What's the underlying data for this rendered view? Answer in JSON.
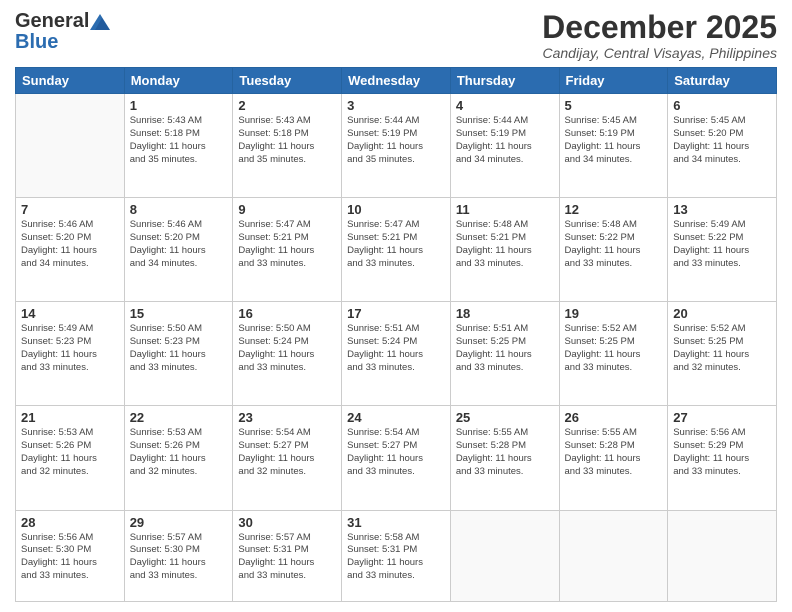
{
  "header": {
    "logo_general": "General",
    "logo_blue": "Blue",
    "month_title": "December 2025",
    "location": "Candijay, Central Visayas, Philippines"
  },
  "days_of_week": [
    "Sunday",
    "Monday",
    "Tuesday",
    "Wednesday",
    "Thursday",
    "Friday",
    "Saturday"
  ],
  "weeks": [
    [
      {
        "day": "",
        "info": ""
      },
      {
        "day": "1",
        "info": "Sunrise: 5:43 AM\nSunset: 5:18 PM\nDaylight: 11 hours\nand 35 minutes."
      },
      {
        "day": "2",
        "info": "Sunrise: 5:43 AM\nSunset: 5:18 PM\nDaylight: 11 hours\nand 35 minutes."
      },
      {
        "day": "3",
        "info": "Sunrise: 5:44 AM\nSunset: 5:19 PM\nDaylight: 11 hours\nand 35 minutes."
      },
      {
        "day": "4",
        "info": "Sunrise: 5:44 AM\nSunset: 5:19 PM\nDaylight: 11 hours\nand 34 minutes."
      },
      {
        "day": "5",
        "info": "Sunrise: 5:45 AM\nSunset: 5:19 PM\nDaylight: 11 hours\nand 34 minutes."
      },
      {
        "day": "6",
        "info": "Sunrise: 5:45 AM\nSunset: 5:20 PM\nDaylight: 11 hours\nand 34 minutes."
      }
    ],
    [
      {
        "day": "7",
        "info": "Sunrise: 5:46 AM\nSunset: 5:20 PM\nDaylight: 11 hours\nand 34 minutes."
      },
      {
        "day": "8",
        "info": "Sunrise: 5:46 AM\nSunset: 5:20 PM\nDaylight: 11 hours\nand 34 minutes."
      },
      {
        "day": "9",
        "info": "Sunrise: 5:47 AM\nSunset: 5:21 PM\nDaylight: 11 hours\nand 33 minutes."
      },
      {
        "day": "10",
        "info": "Sunrise: 5:47 AM\nSunset: 5:21 PM\nDaylight: 11 hours\nand 33 minutes."
      },
      {
        "day": "11",
        "info": "Sunrise: 5:48 AM\nSunset: 5:21 PM\nDaylight: 11 hours\nand 33 minutes."
      },
      {
        "day": "12",
        "info": "Sunrise: 5:48 AM\nSunset: 5:22 PM\nDaylight: 11 hours\nand 33 minutes."
      },
      {
        "day": "13",
        "info": "Sunrise: 5:49 AM\nSunset: 5:22 PM\nDaylight: 11 hours\nand 33 minutes."
      }
    ],
    [
      {
        "day": "14",
        "info": "Sunrise: 5:49 AM\nSunset: 5:23 PM\nDaylight: 11 hours\nand 33 minutes."
      },
      {
        "day": "15",
        "info": "Sunrise: 5:50 AM\nSunset: 5:23 PM\nDaylight: 11 hours\nand 33 minutes."
      },
      {
        "day": "16",
        "info": "Sunrise: 5:50 AM\nSunset: 5:24 PM\nDaylight: 11 hours\nand 33 minutes."
      },
      {
        "day": "17",
        "info": "Sunrise: 5:51 AM\nSunset: 5:24 PM\nDaylight: 11 hours\nand 33 minutes."
      },
      {
        "day": "18",
        "info": "Sunrise: 5:51 AM\nSunset: 5:25 PM\nDaylight: 11 hours\nand 33 minutes."
      },
      {
        "day": "19",
        "info": "Sunrise: 5:52 AM\nSunset: 5:25 PM\nDaylight: 11 hours\nand 33 minutes."
      },
      {
        "day": "20",
        "info": "Sunrise: 5:52 AM\nSunset: 5:25 PM\nDaylight: 11 hours\nand 32 minutes."
      }
    ],
    [
      {
        "day": "21",
        "info": "Sunrise: 5:53 AM\nSunset: 5:26 PM\nDaylight: 11 hours\nand 32 minutes."
      },
      {
        "day": "22",
        "info": "Sunrise: 5:53 AM\nSunset: 5:26 PM\nDaylight: 11 hours\nand 32 minutes."
      },
      {
        "day": "23",
        "info": "Sunrise: 5:54 AM\nSunset: 5:27 PM\nDaylight: 11 hours\nand 32 minutes."
      },
      {
        "day": "24",
        "info": "Sunrise: 5:54 AM\nSunset: 5:27 PM\nDaylight: 11 hours\nand 33 minutes."
      },
      {
        "day": "25",
        "info": "Sunrise: 5:55 AM\nSunset: 5:28 PM\nDaylight: 11 hours\nand 33 minutes."
      },
      {
        "day": "26",
        "info": "Sunrise: 5:55 AM\nSunset: 5:28 PM\nDaylight: 11 hours\nand 33 minutes."
      },
      {
        "day": "27",
        "info": "Sunrise: 5:56 AM\nSunset: 5:29 PM\nDaylight: 11 hours\nand 33 minutes."
      }
    ],
    [
      {
        "day": "28",
        "info": "Sunrise: 5:56 AM\nSunset: 5:30 PM\nDaylight: 11 hours\nand 33 minutes."
      },
      {
        "day": "29",
        "info": "Sunrise: 5:57 AM\nSunset: 5:30 PM\nDaylight: 11 hours\nand 33 minutes."
      },
      {
        "day": "30",
        "info": "Sunrise: 5:57 AM\nSunset: 5:31 PM\nDaylight: 11 hours\nand 33 minutes."
      },
      {
        "day": "31",
        "info": "Sunrise: 5:58 AM\nSunset: 5:31 PM\nDaylight: 11 hours\nand 33 minutes."
      },
      {
        "day": "",
        "info": ""
      },
      {
        "day": "",
        "info": ""
      },
      {
        "day": "",
        "info": ""
      }
    ]
  ]
}
